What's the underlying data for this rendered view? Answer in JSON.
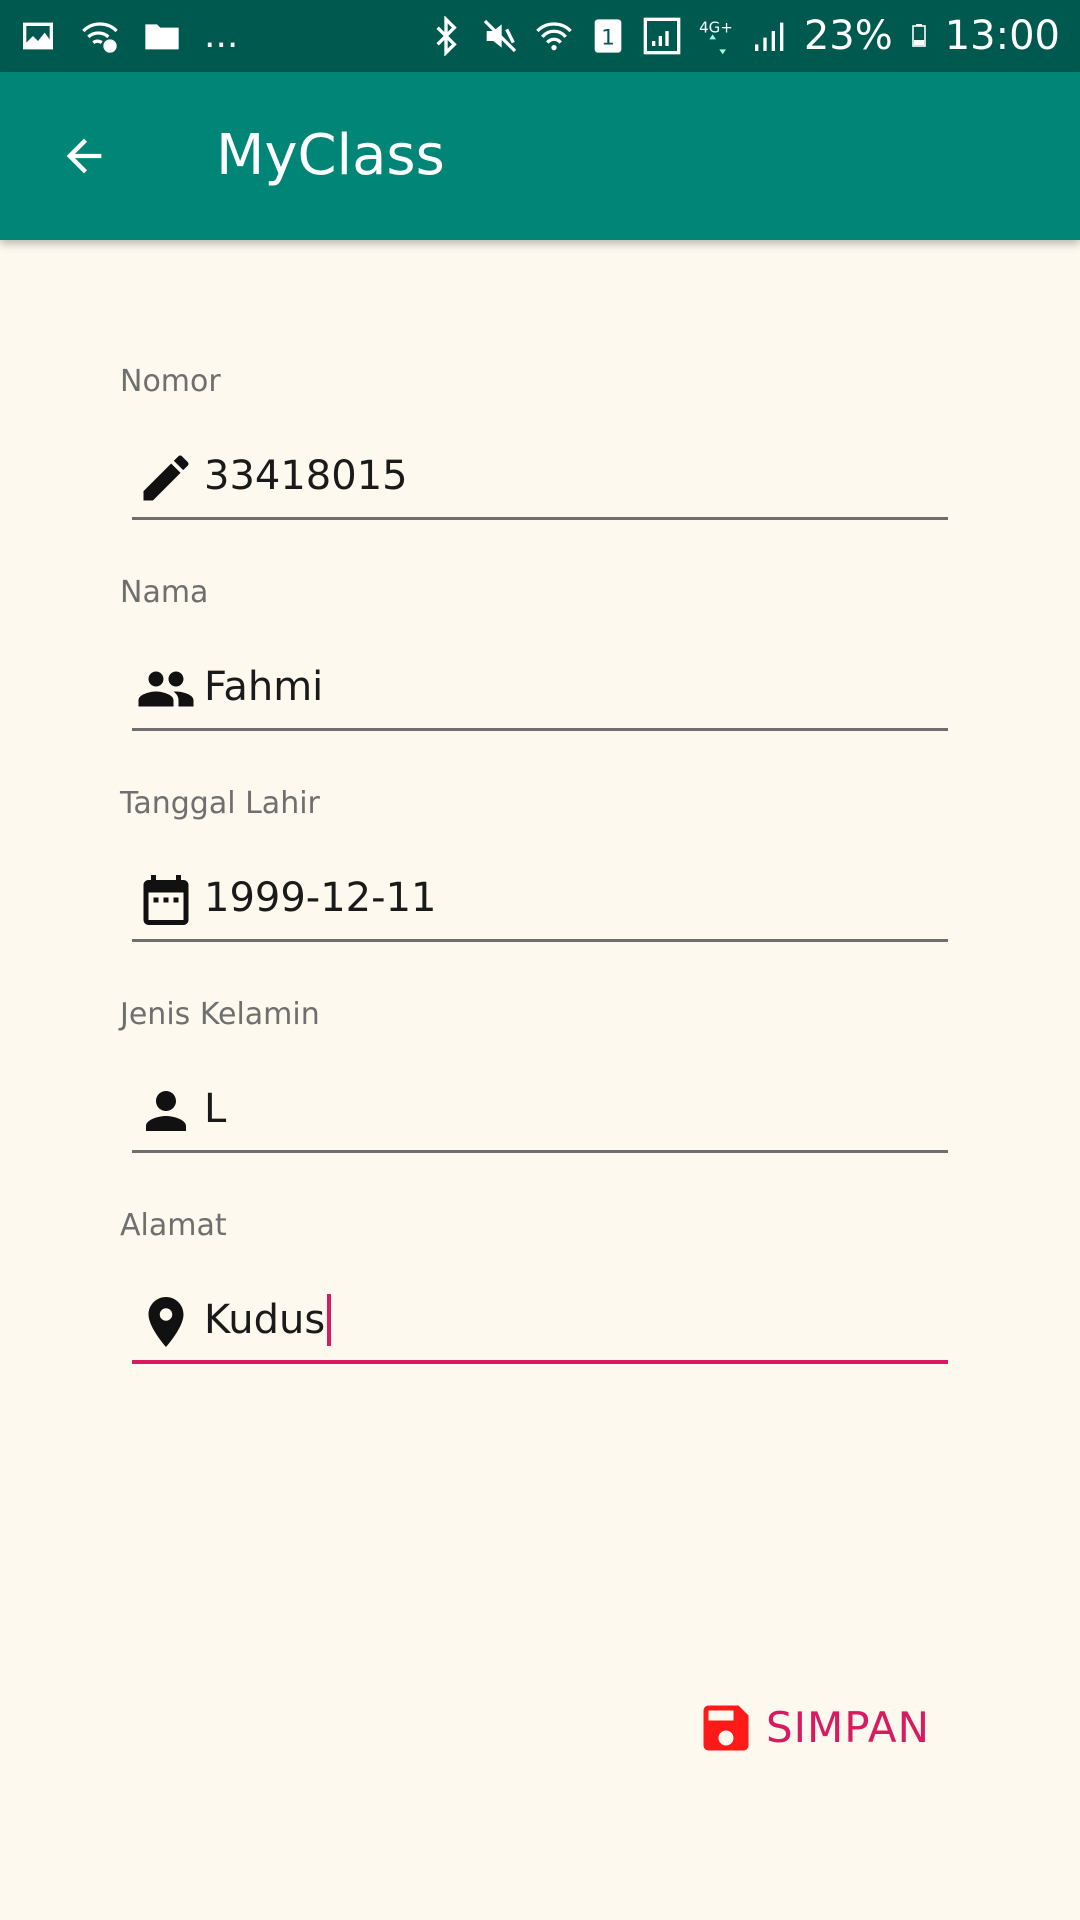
{
  "status_bar": {
    "left_icons": [
      "image-icon",
      "wifi-question-icon",
      "folder-icon"
    ],
    "more": "...",
    "right_icons": [
      "bluetooth-icon",
      "vibrate-mute-icon",
      "wifi-icon",
      "sim-1-icon",
      "signal-icon",
      "network-4g-icon",
      "signal-bars-icon",
      "battery-icon"
    ],
    "battery_percent": "23%",
    "time": "13:00"
  },
  "app_bar": {
    "title": "MyClass",
    "back_icon": "arrow-back-icon",
    "color": "#008577"
  },
  "form": {
    "fields": [
      {
        "label": "Nomor",
        "value": "33418015",
        "icon": "pencil-icon"
      },
      {
        "label": "Nama",
        "value": "Fahmi",
        "icon": "people-icon"
      },
      {
        "label": "Tanggal Lahir",
        "value": "1999-12-11",
        "icon": "calendar-icon"
      },
      {
        "label": "Jenis Kelamin",
        "value": "L",
        "icon": "person-icon"
      },
      {
        "label": "Alamat",
        "value": "Kudus",
        "icon": "location-pin-icon"
      }
    ]
  },
  "save_button": {
    "label": "SIMPAN",
    "icon": "floppy-disk-icon",
    "color": "#d81b60",
    "icon_color": "#ff1a1a"
  }
}
